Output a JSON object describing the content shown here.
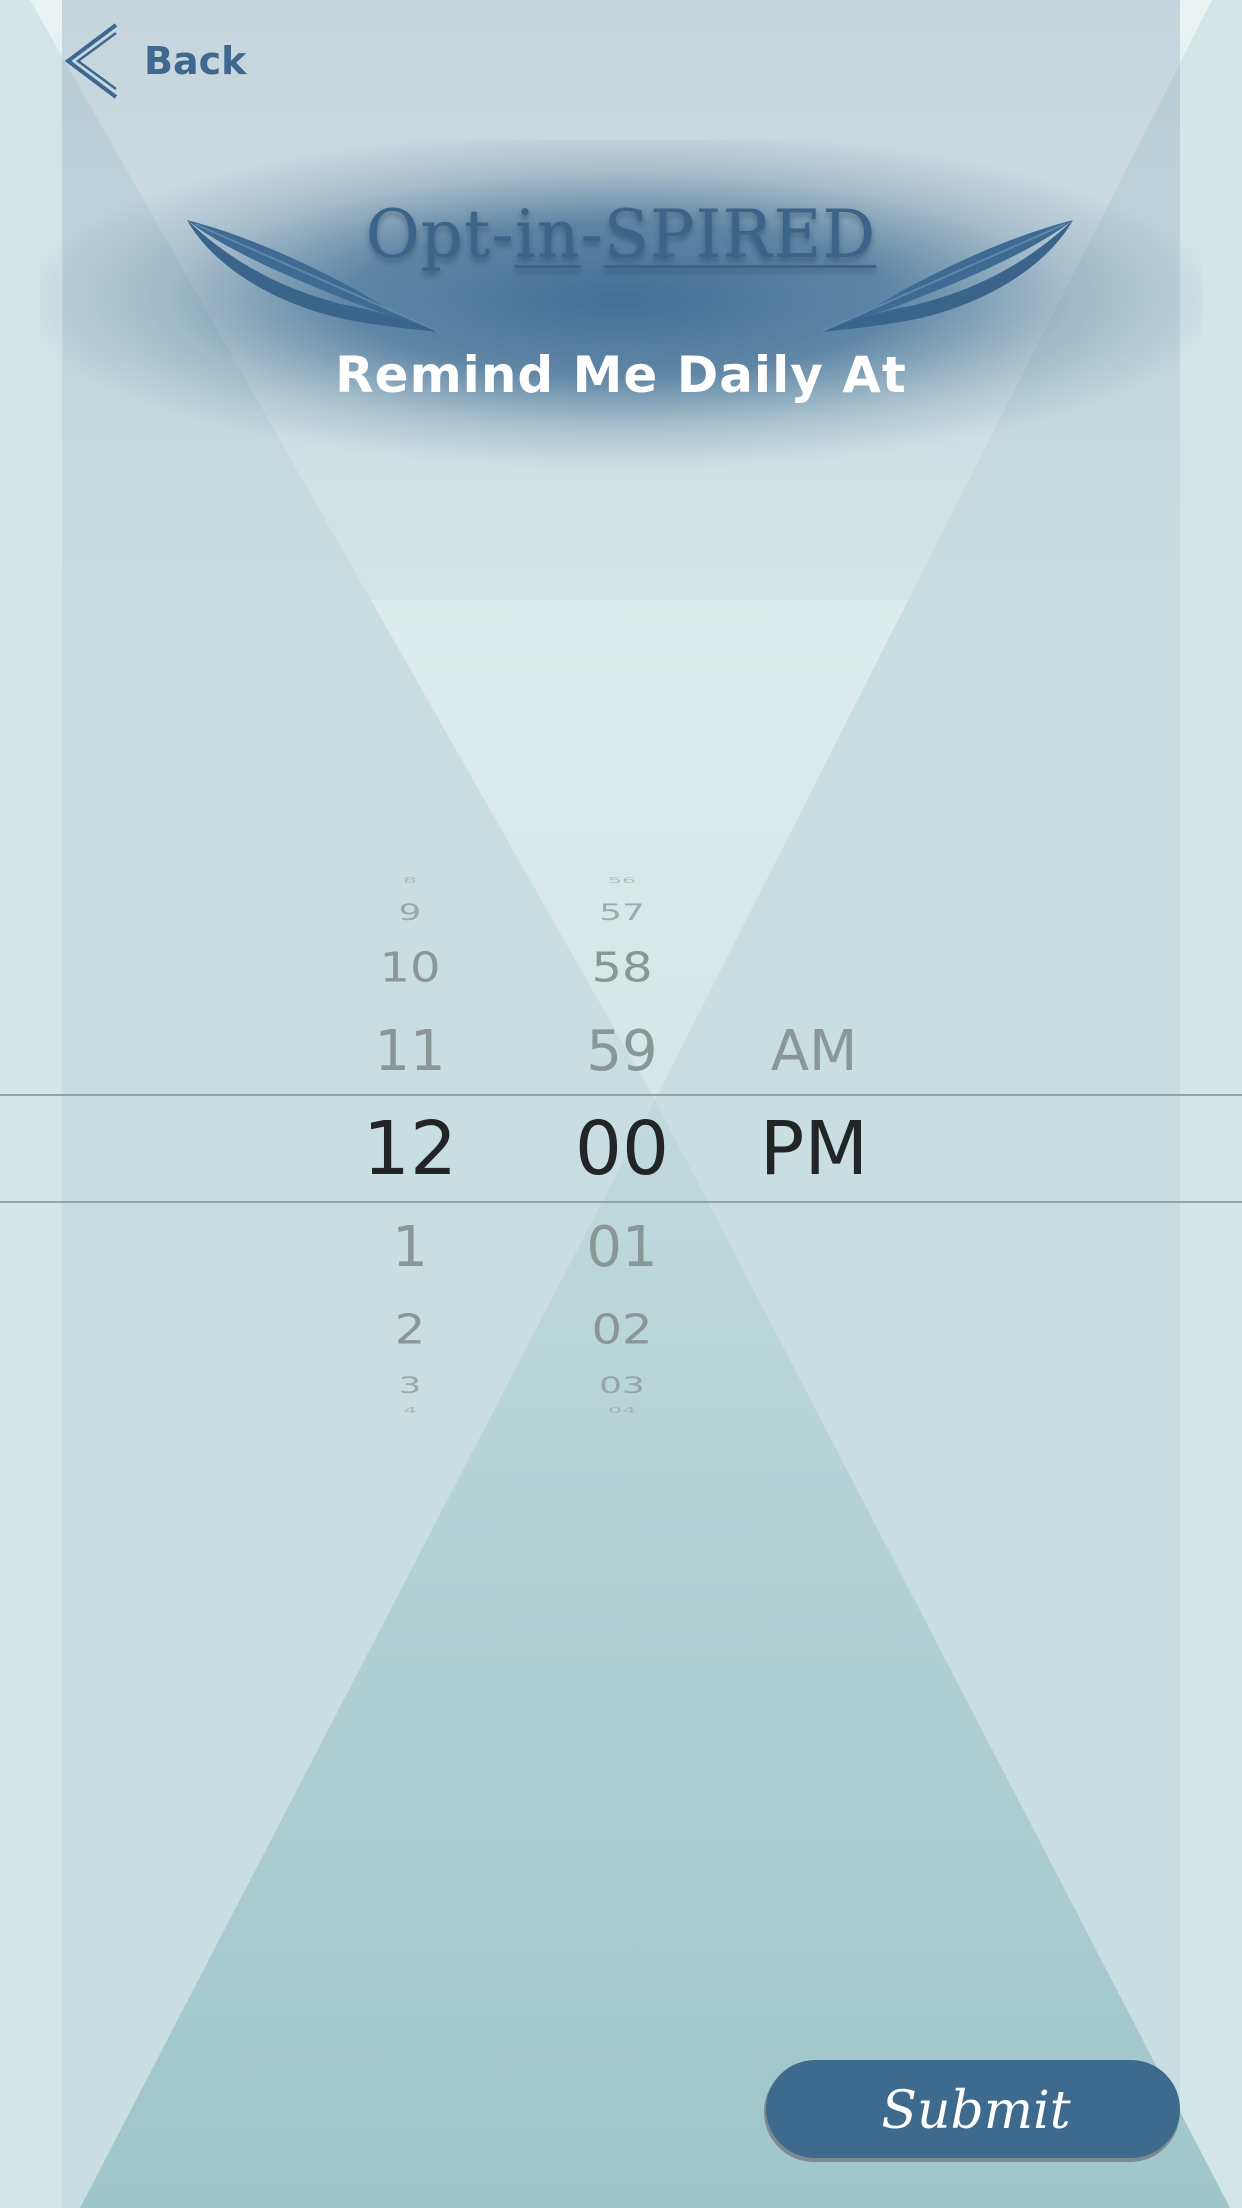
{
  "nav": {
    "back_label": "Back"
  },
  "header": {
    "app_title_prefix": "Opt-",
    "app_title_in": "in",
    "app_title_dash": "-",
    "app_title_suffix": "SPIRED",
    "subtitle": "Remind Me Daily At"
  },
  "picker": {
    "hours": {
      "above": [
        "8",
        "9",
        "10",
        "11"
      ],
      "selected": "12",
      "below": [
        "1",
        "2",
        "3",
        "4"
      ]
    },
    "minutes": {
      "above": [
        "56",
        "57",
        "58",
        "59"
      ],
      "selected": "00",
      "below": [
        "01",
        "02",
        "03",
        "04"
      ]
    },
    "period": {
      "above": [
        "AM"
      ],
      "selected": "PM"
    }
  },
  "actions": {
    "submit_label": "Submit"
  },
  "colors": {
    "accent": "#3e6890",
    "background": "#c8dfe1",
    "submit_bg": "#3d6a8d"
  }
}
